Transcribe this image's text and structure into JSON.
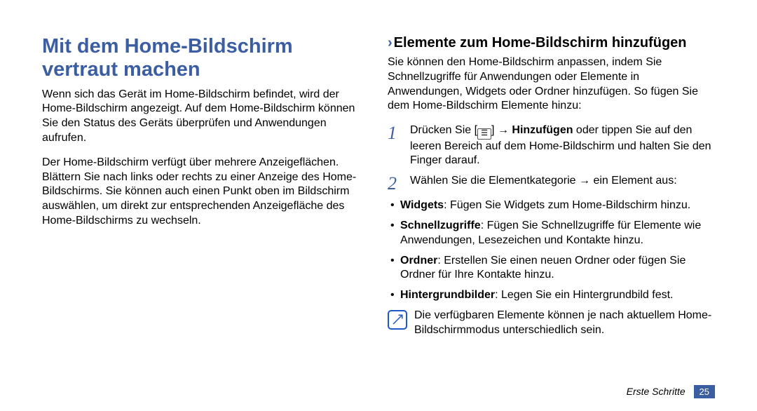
{
  "left": {
    "title": "Mit dem Home-Bildschirm vertraut machen",
    "para1": "Wenn sich das Gerät im Home-Bildschirm befindet, wird der Home-Bildschirm angezeigt. Auf dem Home-Bildschirm können Sie den Status des Geräts überprüfen und Anwendungen aufrufen.",
    "para2": "Der Home-Bildschirm verfügt über mehrere Anzeigeflächen. Blättern Sie nach links oder rechts zu einer Anzeige des Home-Bildschirms. Sie können auch einen Punkt oben im Bildschirm auswählen, um direkt zur entsprechenden Anzeigefläche des Home-Bildschirms zu wechseln."
  },
  "right": {
    "chevron": "›",
    "subtitle": "Elemente zum Home-Bildschirm hinzufügen",
    "intro": "Sie können den Home-Bildschirm anpassen, indem Sie Schnellzugriffe für Anwendungen oder Elemente in Anwendungen, Widgets oder Ordner hinzufügen. So fügen Sie dem Home-Bildschirm Elemente hinzu:",
    "step1_pre": "Drücken Sie [",
    "step1_arrow": "] → ",
    "step1_bold": "Hinzufügen",
    "step1_post": " oder tippen Sie auf den leeren Bereich auf dem Home-Bildschirm und halten Sie den Finger darauf.",
    "step2": "Wählen Sie die Elementkategorie → ein Element aus:",
    "bullets": {
      "b1_bold": "Widgets",
      "b1_text": ": Fügen Sie Widgets zum Home-Bildschirm hinzu.",
      "b2_bold": "Schnellzugriffe",
      "b2_text": ": Fügen Sie Schnellzugriffe für Elemente wie Anwendungen, Lesezeichen und Kontakte hinzu.",
      "b3_bold": "Ordner",
      "b3_text": ": Erstellen Sie einen neuen Ordner oder fügen Sie Ordner für Ihre Kontakte hinzu.",
      "b4_bold": "Hintergrundbilder",
      "b4_text": ": Legen Sie ein Hintergrundbild fest."
    },
    "note": "Die verfügbaren Elemente können je nach aktuellem Home-Bildschirmmodus unterschiedlich sein."
  },
  "footer": {
    "label": "Erste Schritte",
    "page": "25"
  },
  "stepnums": {
    "one": "1",
    "two": "2"
  }
}
